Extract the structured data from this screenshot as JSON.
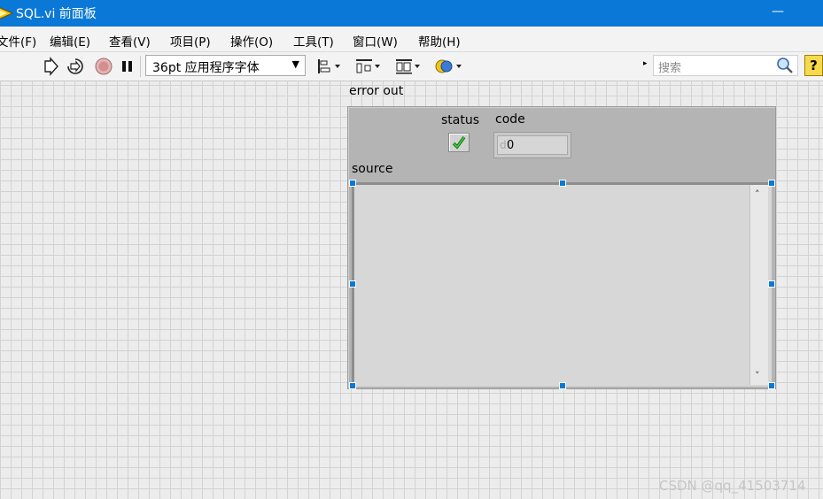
{
  "window": {
    "title": "SQL.vi 前面板",
    "minimize_glyph": "—",
    "app_icon": "labview-run-arrow-icon"
  },
  "menu": {
    "items": [
      "文件(F)",
      "编辑(E)",
      "查看(V)",
      "项目(P)",
      "操作(O)",
      "工具(T)",
      "窗口(W)",
      "帮助(H)"
    ]
  },
  "toolbar": {
    "icons": [
      "run-arrow-icon",
      "run-continuously-icon",
      "abort-execution-icon",
      "pause-icon"
    ],
    "font_select_value": "36pt 应用程序字体",
    "layout_icons": [
      "align-objects-icon",
      "distribute-objects-icon",
      "resize-objects-icon",
      "reorder-icon"
    ],
    "search_placeholder": "搜索",
    "help_label": "?"
  },
  "front_panel": {
    "cluster_label": "error out",
    "status_label": "status",
    "status_value": "true",
    "code_label": "code",
    "code_radix": "d",
    "code_value": "0",
    "source_label": "source",
    "source_value": "",
    "scroll_up": "˄",
    "scroll_down": "˅"
  },
  "watermark": "CSDN @qq_41503714",
  "colors": {
    "titlebar": "#0a78d7",
    "selection_handle": "#0a78d7",
    "status_check": "#19a319",
    "help_button": "#f7d94c"
  }
}
